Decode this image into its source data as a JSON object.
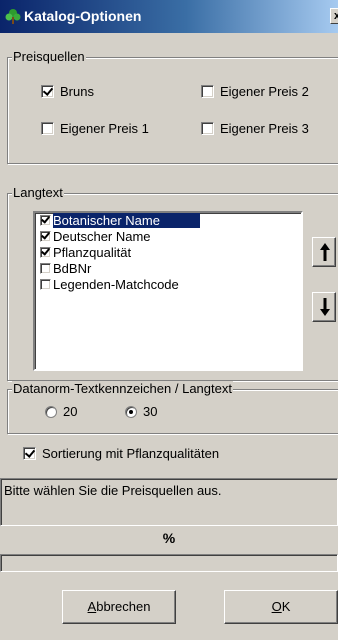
{
  "window": {
    "title": "Katalog-Optionen",
    "close_label": "x",
    "icon": "plant-icon"
  },
  "preisquellen": {
    "legend": "Preisquellen",
    "options": [
      {
        "label": "Bruns",
        "checked": true
      },
      {
        "label": "Eigener Preis 2",
        "checked": false
      },
      {
        "label": "Eigener Preis 1",
        "checked": false
      },
      {
        "label": "Eigener Preis 3",
        "checked": false
      }
    ]
  },
  "langtext": {
    "legend": "Langtext",
    "items": [
      {
        "label": "Botanischer Name",
        "checked": true,
        "selected": true
      },
      {
        "label": "Deutscher Name",
        "checked": true,
        "selected": false
      },
      {
        "label": "Pflanzqualität",
        "checked": true,
        "selected": false
      },
      {
        "label": "BdBNr",
        "checked": false,
        "selected": false
      },
      {
        "label": "Legenden-Matchcode",
        "checked": false,
        "selected": false
      }
    ],
    "move_up_icon": "arrow-up-icon",
    "move_down_icon": "arrow-down-icon"
  },
  "datanorm": {
    "legend": "Datanorm-Textkennzeichen / Langtext",
    "options": [
      {
        "label": "20",
        "selected": false
      },
      {
        "label": "30",
        "selected": true
      }
    ]
  },
  "sortierung": {
    "label": "Sortierung mit Pflanzqualitäten",
    "checked": true
  },
  "status_text": "Bitte wählen Sie die Preisquellen aus.",
  "progress": {
    "label": "%",
    "fraction": 0
  },
  "buttons": {
    "cancel": {
      "accel": "A",
      "rest": "bbrechen"
    },
    "ok": {
      "accel": "O",
      "rest": "K"
    }
  }
}
